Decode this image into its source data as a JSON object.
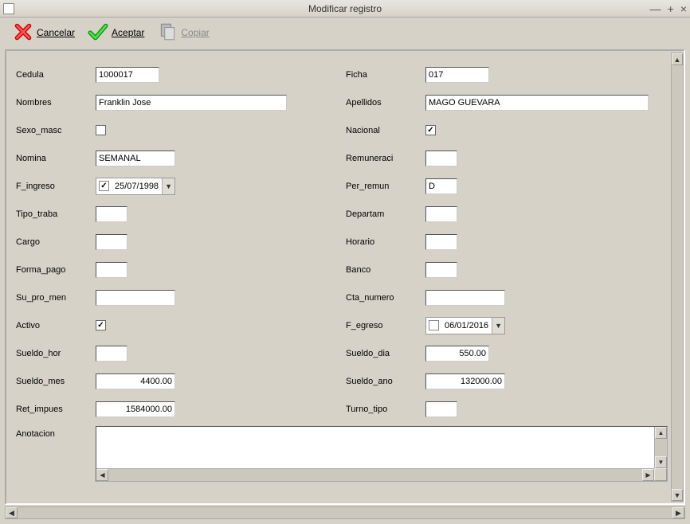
{
  "window": {
    "title": "Modificar registro",
    "minimize": "—",
    "maximize": "+",
    "close": "×"
  },
  "toolbar": {
    "cancel": "Cancelar",
    "accept": "Aceptar",
    "copy": "Copiar"
  },
  "labels": {
    "cedula": "Cedula",
    "nombres": "Nombres",
    "sexo_masc": "Sexo_masc",
    "nomina": "Nomina",
    "f_ingreso": "F_ingreso",
    "tipo_traba": "Tipo_traba",
    "cargo": "Cargo",
    "forma_pago": "Forma_pago",
    "su_pro_men": "Su_pro_men",
    "activo": "Activo",
    "sueldo_hor": "Sueldo_hor",
    "sueldo_mes": "Sueldo_mes",
    "ret_impues": "Ret_impues",
    "anotacion": "Anotacion",
    "ficha": "Ficha",
    "apellidos": "Apellidos",
    "nacional": "Nacional",
    "remuneraci": "Remuneraci",
    "per_remun": "Per_remun",
    "departam": "Departam",
    "horario": "Horario",
    "banco": "Banco",
    "cta_numero": "Cta_numero",
    "f_egreso": "F_egreso",
    "sueldo_dia": "Sueldo_dia",
    "sueldo_ano": "Sueldo_ano",
    "turno_tipo": "Turno_tipo"
  },
  "values": {
    "cedula": "1000017",
    "nombres": "Franklin Jose",
    "sexo_masc": false,
    "nomina": "SEMANAL",
    "f_ingreso_enabled": true,
    "f_ingreso": "25/07/1998",
    "tipo_traba": "",
    "cargo": "",
    "forma_pago": "",
    "su_pro_men": "",
    "activo": true,
    "sueldo_hor": "",
    "sueldo_mes": "4400.00",
    "ret_impues": "1584000.00",
    "anotacion": "",
    "ficha": "017",
    "apellidos": "MAGO GUEVARA",
    "nacional": true,
    "remuneraci": "",
    "per_remun": "D",
    "departam": "",
    "horario": "",
    "banco": "",
    "cta_numero": "",
    "f_egreso_enabled": false,
    "f_egreso": "06/01/2016",
    "sueldo_dia": "550.00",
    "sueldo_ano": "132000.00",
    "turno_tipo": ""
  }
}
